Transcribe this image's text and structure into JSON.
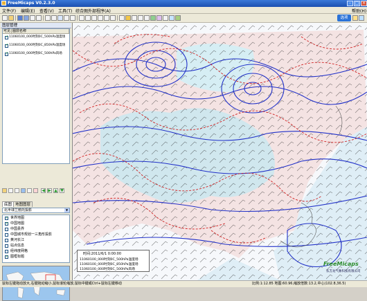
{
  "window": {
    "title": "FreeMicaps V0.2.3.0"
  },
  "menu": [
    "文件(F)",
    "编辑(E)",
    "查看(V)",
    "工具(T)",
    "综合图",
    "外部程序(A)",
    "帮助(H)"
  ],
  "toolbar": {
    "hint": "选项"
  },
  "layer_panel": {
    "title": "图层管理",
    "columns": [
      "可见",
      "图层名称"
    ],
    "items": [
      {
        "visible": true,
        "name": "11060100_000时刻0C_500hPa温度场"
      },
      {
        "visible": true,
        "name": "11060100_000时刻0C_850hPa温度场"
      },
      {
        "visible": true,
        "name": "11060100_000时刻0C_500hPa风场"
      }
    ]
  },
  "basemap_panel": {
    "tabs": [
      "底图",
      "地图图层"
    ],
    "projection": "北半球兰勃托投影",
    "layers": [
      {
        "checked": true,
        "name": "世界地图"
      },
      {
        "checked": true,
        "name": "中国地图"
      },
      {
        "checked": false,
        "name": "中国县界"
      },
      {
        "checked": false,
        "name": "中国城市规划一三角形投影"
      },
      {
        "checked": false,
        "name": "黄河长江"
      },
      {
        "checked": false,
        "name": "站点信息"
      },
      {
        "checked": false,
        "name": "经纬度网格"
      },
      {
        "checked": true,
        "name": "图框标题"
      }
    ]
  },
  "map_legend": {
    "time": "时间:2011/6/1  0:00:00",
    "items": [
      "11060100_000时刻0C_500hPa温度场",
      "11060100_000时刻0C_850hPa温度场",
      "11060100_000时刻0C_500hPa风场"
    ]
  },
  "logo": "FreeMicaps",
  "logo_sub": "东方龙气象科技有限公司",
  "status": {
    "left": "鼠标左键拖动放大,右键拖动缩小,鼠标滚轮缩放,鼠标中键或Ctrl+鼠标左键移动",
    "right": "比例:1:12.85 地图:60.96,缩放倍数:13.2,中心(102.8,36.5)"
  },
  "colors": {
    "height_contour": "#2030c8",
    "temp_contour": "#d02020",
    "land": "#f4dede",
    "sea": "#dfeef6",
    "cold": "#c9e8f0"
  }
}
